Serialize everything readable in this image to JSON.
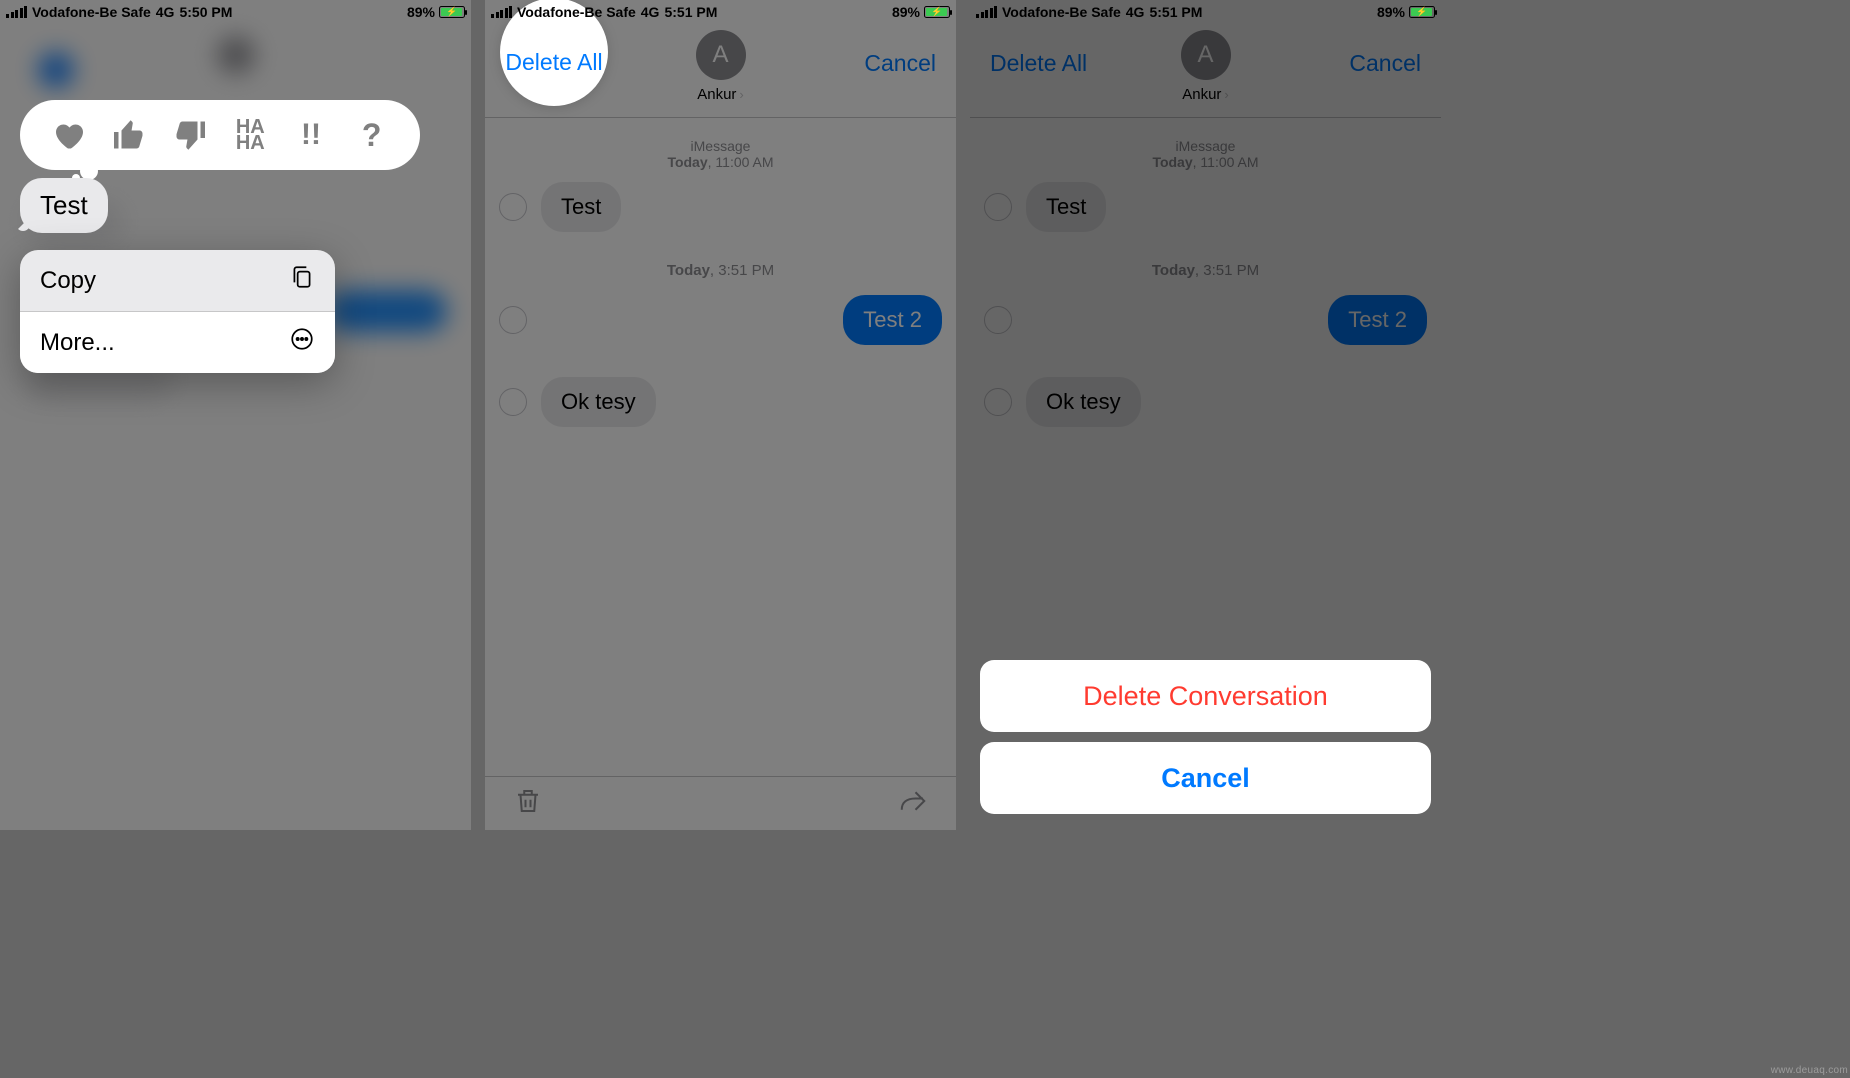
{
  "status": {
    "carrier": "Vodafone-Be Safe",
    "network": "4G",
    "battery_pct": "89%"
  },
  "screen1": {
    "time": "5:50 PM",
    "selected_msg": "Test",
    "menu": {
      "copy": "Copy",
      "more": "More..."
    }
  },
  "screen2": {
    "time": "5:51 PM",
    "delete_all": "Delete All",
    "cancel": "Cancel",
    "contact": {
      "name": "Ankur",
      "initial": "A"
    },
    "imsg": "iMessage",
    "stamp1_day": "Today",
    "stamp1_time": ", 11:00 AM",
    "stamp2_day": "Today",
    "stamp2_time": ", 3:51 PM",
    "msg1": "Test",
    "msg2": "Test 2",
    "msg3": "Ok tesy"
  },
  "screen3": {
    "time": "5:51 PM",
    "delete_all": "Delete All",
    "cancel_top": "Cancel",
    "contact": {
      "name": "Ankur",
      "initial": "A"
    },
    "imsg": "iMessage",
    "stamp1_day": "Today",
    "stamp1_time": ", 11:00 AM",
    "stamp2_day": "Today",
    "stamp2_time": ", 3:51 PM",
    "msg1": "Test",
    "msg2": "Test 2",
    "msg3": "Ok tesy",
    "sheet_delete": "Delete Conversation",
    "sheet_cancel": "Cancel"
  },
  "watermark": "www.deuaq.com"
}
